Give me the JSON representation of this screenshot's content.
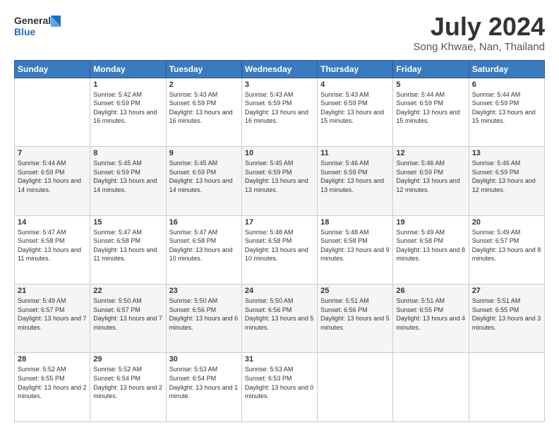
{
  "header": {
    "logo_line1": "General",
    "logo_line2": "Blue",
    "month": "July 2024",
    "location": "Song Khwae, Nan, Thailand"
  },
  "days_of_week": [
    "Sunday",
    "Monday",
    "Tuesday",
    "Wednesday",
    "Thursday",
    "Friday",
    "Saturday"
  ],
  "weeks": [
    [
      {
        "day": "",
        "sunrise": "",
        "sunset": "",
        "daylight": ""
      },
      {
        "day": "1",
        "sunrise": "Sunrise: 5:42 AM",
        "sunset": "Sunset: 6:59 PM",
        "daylight": "Daylight: 13 hours and 16 minutes."
      },
      {
        "day": "2",
        "sunrise": "Sunrise: 5:43 AM",
        "sunset": "Sunset: 6:59 PM",
        "daylight": "Daylight: 13 hours and 16 minutes."
      },
      {
        "day": "3",
        "sunrise": "Sunrise: 5:43 AM",
        "sunset": "Sunset: 6:59 PM",
        "daylight": "Daylight: 13 hours and 16 minutes."
      },
      {
        "day": "4",
        "sunrise": "Sunrise: 5:43 AM",
        "sunset": "Sunset: 6:59 PM",
        "daylight": "Daylight: 13 hours and 15 minutes."
      },
      {
        "day": "5",
        "sunrise": "Sunrise: 5:44 AM",
        "sunset": "Sunset: 6:59 PM",
        "daylight": "Daylight: 13 hours and 15 minutes."
      },
      {
        "day": "6",
        "sunrise": "Sunrise: 5:44 AM",
        "sunset": "Sunset: 6:59 PM",
        "daylight": "Daylight: 13 hours and 15 minutes."
      }
    ],
    [
      {
        "day": "7",
        "sunrise": "Sunrise: 5:44 AM",
        "sunset": "Sunset: 6:59 PM",
        "daylight": "Daylight: 13 hours and 14 minutes."
      },
      {
        "day": "8",
        "sunrise": "Sunrise: 5:45 AM",
        "sunset": "Sunset: 6:59 PM",
        "daylight": "Daylight: 13 hours and 14 minutes."
      },
      {
        "day": "9",
        "sunrise": "Sunrise: 5:45 AM",
        "sunset": "Sunset: 6:59 PM",
        "daylight": "Daylight: 13 hours and 14 minutes."
      },
      {
        "day": "10",
        "sunrise": "Sunrise: 5:45 AM",
        "sunset": "Sunset: 6:59 PM",
        "daylight": "Daylight: 13 hours and 13 minutes."
      },
      {
        "day": "11",
        "sunrise": "Sunrise: 5:46 AM",
        "sunset": "Sunset: 6:59 PM",
        "daylight": "Daylight: 13 hours and 13 minutes."
      },
      {
        "day": "12",
        "sunrise": "Sunrise: 5:46 AM",
        "sunset": "Sunset: 6:59 PM",
        "daylight": "Daylight: 13 hours and 12 minutes."
      },
      {
        "day": "13",
        "sunrise": "Sunrise: 5:46 AM",
        "sunset": "Sunset: 6:59 PM",
        "daylight": "Daylight: 13 hours and 12 minutes."
      }
    ],
    [
      {
        "day": "14",
        "sunrise": "Sunrise: 5:47 AM",
        "sunset": "Sunset: 6:58 PM",
        "daylight": "Daylight: 13 hours and 11 minutes."
      },
      {
        "day": "15",
        "sunrise": "Sunrise: 5:47 AM",
        "sunset": "Sunset: 6:58 PM",
        "daylight": "Daylight: 13 hours and 11 minutes."
      },
      {
        "day": "16",
        "sunrise": "Sunrise: 5:47 AM",
        "sunset": "Sunset: 6:58 PM",
        "daylight": "Daylight: 13 hours and 10 minutes."
      },
      {
        "day": "17",
        "sunrise": "Sunrise: 5:48 AM",
        "sunset": "Sunset: 6:58 PM",
        "daylight": "Daylight: 13 hours and 10 minutes."
      },
      {
        "day": "18",
        "sunrise": "Sunrise: 5:48 AM",
        "sunset": "Sunset: 6:58 PM",
        "daylight": "Daylight: 13 hours and 9 minutes."
      },
      {
        "day": "19",
        "sunrise": "Sunrise: 5:49 AM",
        "sunset": "Sunset: 6:58 PM",
        "daylight": "Daylight: 13 hours and 8 minutes."
      },
      {
        "day": "20",
        "sunrise": "Sunrise: 5:49 AM",
        "sunset": "Sunset: 6:57 PM",
        "daylight": "Daylight: 13 hours and 8 minutes."
      }
    ],
    [
      {
        "day": "21",
        "sunrise": "Sunrise: 5:49 AM",
        "sunset": "Sunset: 6:57 PM",
        "daylight": "Daylight: 13 hours and 7 minutes."
      },
      {
        "day": "22",
        "sunrise": "Sunrise: 5:50 AM",
        "sunset": "Sunset: 6:57 PM",
        "daylight": "Daylight: 13 hours and 7 minutes."
      },
      {
        "day": "23",
        "sunrise": "Sunrise: 5:50 AM",
        "sunset": "Sunset: 6:56 PM",
        "daylight": "Daylight: 13 hours and 6 minutes."
      },
      {
        "day": "24",
        "sunrise": "Sunrise: 5:50 AM",
        "sunset": "Sunset: 6:56 PM",
        "daylight": "Daylight: 13 hours and 5 minutes."
      },
      {
        "day": "25",
        "sunrise": "Sunrise: 5:51 AM",
        "sunset": "Sunset: 6:56 PM",
        "daylight": "Daylight: 13 hours and 5 minutes."
      },
      {
        "day": "26",
        "sunrise": "Sunrise: 5:51 AM",
        "sunset": "Sunset: 6:55 PM",
        "daylight": "Daylight: 13 hours and 4 minutes."
      },
      {
        "day": "27",
        "sunrise": "Sunrise: 5:51 AM",
        "sunset": "Sunset: 6:55 PM",
        "daylight": "Daylight: 13 hours and 3 minutes."
      }
    ],
    [
      {
        "day": "28",
        "sunrise": "Sunrise: 5:52 AM",
        "sunset": "Sunset: 6:55 PM",
        "daylight": "Daylight: 13 hours and 2 minutes."
      },
      {
        "day": "29",
        "sunrise": "Sunrise: 5:52 AM",
        "sunset": "Sunset: 6:54 PM",
        "daylight": "Daylight: 13 hours and 2 minutes."
      },
      {
        "day": "30",
        "sunrise": "Sunrise: 5:53 AM",
        "sunset": "Sunset: 6:54 PM",
        "daylight": "Daylight: 13 hours and 1 minute."
      },
      {
        "day": "31",
        "sunrise": "Sunrise: 5:53 AM",
        "sunset": "Sunset: 6:53 PM",
        "daylight": "Daylight: 13 hours and 0 minutes."
      },
      {
        "day": "",
        "sunrise": "",
        "sunset": "",
        "daylight": ""
      },
      {
        "day": "",
        "sunrise": "",
        "sunset": "",
        "daylight": ""
      },
      {
        "day": "",
        "sunrise": "",
        "sunset": "",
        "daylight": ""
      }
    ]
  ]
}
